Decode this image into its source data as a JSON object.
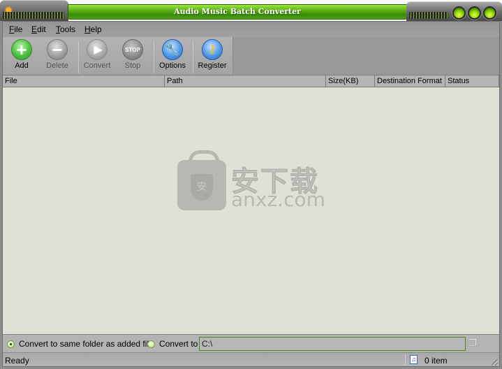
{
  "window": {
    "title": "Audio Music Batch Converter",
    "buttons": [
      "minimize",
      "maximize",
      "close"
    ],
    "accent_color": "#5cb019"
  },
  "menubar": {
    "items": [
      {
        "label": "File",
        "mnemonic": "F",
        "rest": "ile"
      },
      {
        "label": "Edit",
        "mnemonic": "E",
        "rest": "dit"
      },
      {
        "label": "Tools",
        "mnemonic": "T",
        "rest": "ools"
      },
      {
        "label": "Help",
        "mnemonic": "H",
        "rest": "elp"
      }
    ]
  },
  "toolbar": {
    "buttons": [
      {
        "label": "Add",
        "icon": "plus-icon",
        "enabled": true
      },
      {
        "label": "Delete",
        "icon": "minus-icon",
        "enabled": false
      },
      {
        "label": "Convert",
        "icon": "play-icon",
        "enabled": false
      },
      {
        "label": "Stop",
        "icon": "stop-icon",
        "icon_text": "STOP",
        "enabled": false
      },
      {
        "label": "Options",
        "icon": "wrench-icon",
        "enabled": true
      },
      {
        "label": "Register",
        "icon": "key-icon",
        "enabled": true
      }
    ]
  },
  "file_list": {
    "columns": [
      "File",
      "Path",
      "Size(KB)",
      "Destination Format",
      "Status"
    ],
    "rows": []
  },
  "watermark": {
    "cn": "安下载",
    "en": "anxz.com",
    "badge": "安"
  },
  "output": {
    "option_same_folder": "Convert to same folder as added file",
    "option_convert_to": "Convert to",
    "selected": "same_folder",
    "path_value": "C:\\"
  },
  "status": {
    "text": "Ready",
    "item_count": "0 item"
  }
}
